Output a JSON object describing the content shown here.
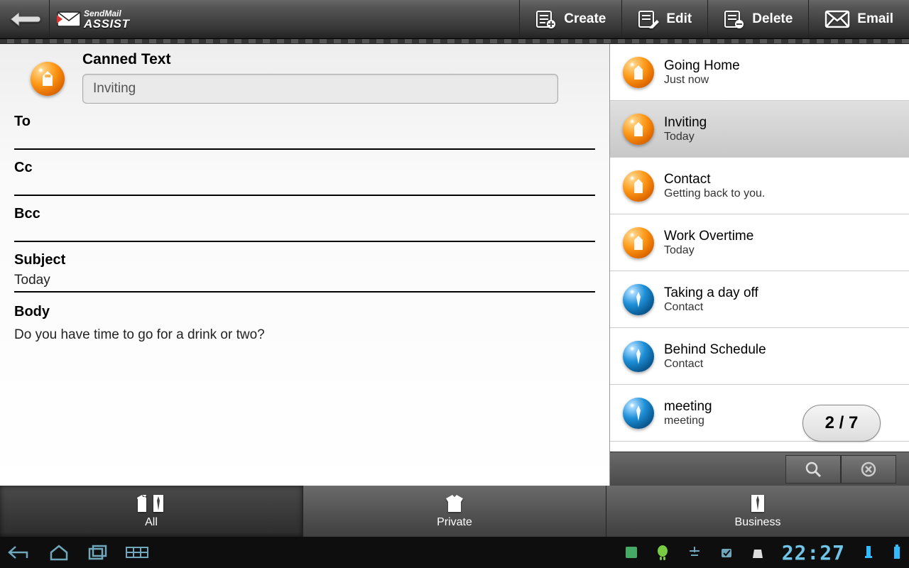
{
  "brand": {
    "line1": "SendMail",
    "line2": "ASSIST"
  },
  "toolbar": {
    "create": "Create",
    "edit": "Edit",
    "delete": "Delete",
    "email": "Email"
  },
  "cannedText": {
    "heading": "Canned Text",
    "value": "Inviting"
  },
  "compose": {
    "labels": {
      "to": "To",
      "cc": "Cc",
      "bcc": "Bcc",
      "subject": "Subject",
      "body": "Body"
    },
    "to": "",
    "cc": "",
    "bcc": "",
    "subject": "Today",
    "body": "Do you have time to go for a drink or two?"
  },
  "list": {
    "pager": "2 / 7",
    "items": [
      {
        "title": "Going Home",
        "sub": "Just now",
        "color": "orange",
        "selected": false
      },
      {
        "title": "Inviting",
        "sub": "Today",
        "color": "orange",
        "selected": true
      },
      {
        "title": "Contact",
        "sub": "Getting back to you.",
        "color": "orange",
        "selected": false
      },
      {
        "title": "Work Overtime",
        "sub": "Today",
        "color": "orange",
        "selected": false
      },
      {
        "title": "Taking a day off",
        "sub": "Contact",
        "color": "blue",
        "selected": false
      },
      {
        "title": "Behind Schedule",
        "sub": "Contact",
        "color": "blue",
        "selected": false
      },
      {
        "title": "meeting",
        "sub": "meeting",
        "color": "blue",
        "selected": false
      }
    ]
  },
  "tabs": {
    "all": "All",
    "private": "Private",
    "business": "Business",
    "active": "all"
  },
  "system": {
    "time": "22:27"
  }
}
